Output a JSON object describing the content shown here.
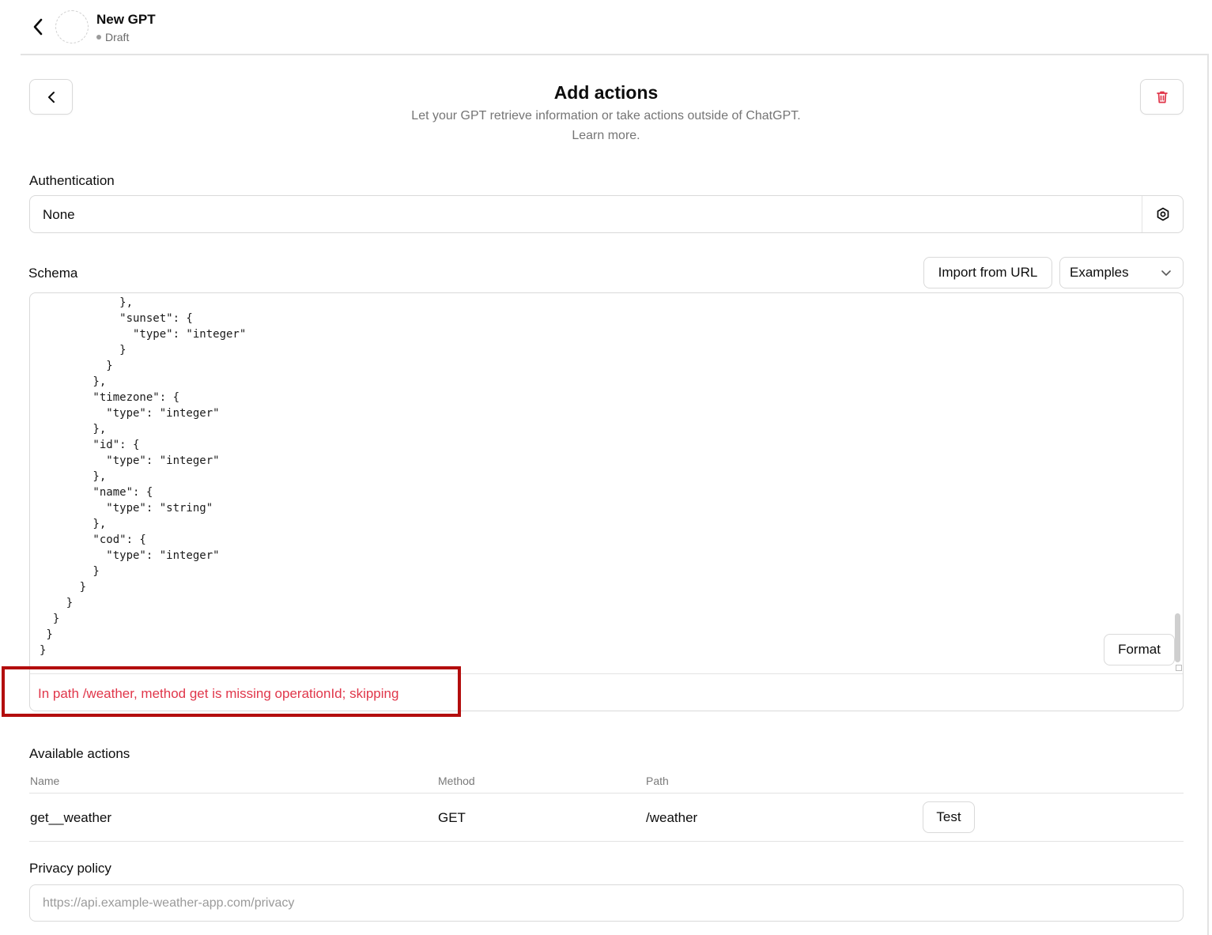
{
  "header": {
    "gpt_name": "New GPT",
    "status": "Draft"
  },
  "page": {
    "title": "Add actions",
    "subtitle": "Let your GPT retrieve information or take actions outside of ChatGPT.",
    "learn_more": "Learn more."
  },
  "authentication": {
    "label": "Authentication",
    "value": "None"
  },
  "schema": {
    "label": "Schema",
    "import_button": "Import from URL",
    "examples_button": "Examples",
    "format_button": "Format",
    "code_lines": [
      "            },",
      "            \"sunset\": {",
      "              \"type\": \"integer\"",
      "            }",
      "          }",
      "        },",
      "        \"timezone\": {",
      "          \"type\": \"integer\"",
      "        },",
      "        \"id\": {",
      "          \"type\": \"integer\"",
      "        },",
      "        \"name\": {",
      "          \"type\": \"string\"",
      "        },",
      "        \"cod\": {",
      "          \"type\": \"integer\"",
      "        }",
      "      }",
      "    }",
      "  }",
      " }",
      "}"
    ],
    "error": "In path /weather, method get is missing operationId; skipping"
  },
  "available_actions": {
    "label": "Available actions",
    "columns": [
      "Name",
      "Method",
      "Path"
    ],
    "rows": [
      {
        "name": "get__weather",
        "method": "GET",
        "path": "/weather",
        "test_label": "Test"
      }
    ]
  },
  "privacy": {
    "label": "Privacy policy",
    "placeholder": "https://api.example-weather-app.com/privacy"
  },
  "colors": {
    "error": "#e0364a",
    "delete_icon": "#e0364a",
    "highlight_border": "#b30d0d"
  },
  "icons": [
    "chevron-left-icon",
    "trash-icon",
    "gear-icon",
    "chevron-down-icon"
  ]
}
